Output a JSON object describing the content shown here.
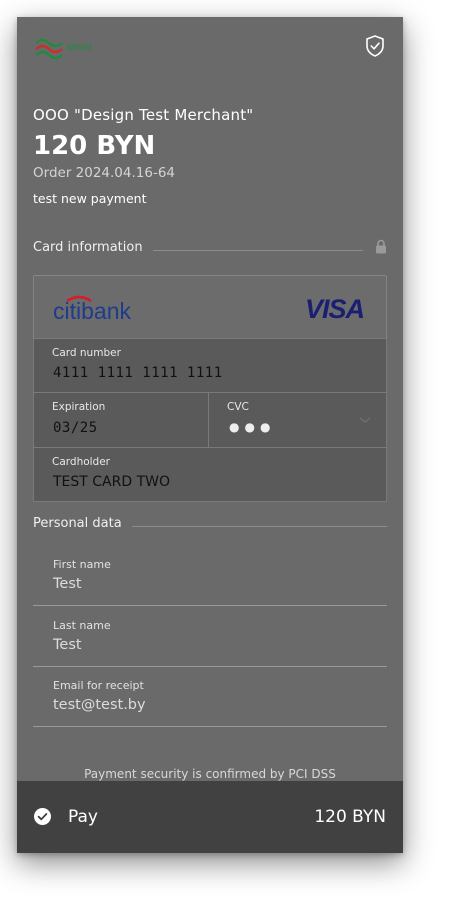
{
  "header": {
    "brand_text": "assist"
  },
  "merchant": {
    "name": "ООО \"Design Test Merchant\"",
    "amount": "120 BYN",
    "order": "Order 2024.04.16-64",
    "description": "test new payment"
  },
  "card_section": {
    "title": "Card information",
    "bank_logo": "citibank",
    "network": "VISA",
    "card_number_label": "Card number",
    "card_number": "4111  1111  1111  1111",
    "expiration_label": "Expiration",
    "expiration": "03/25",
    "cvc_label": "CVC",
    "cvc_masked": "●●●",
    "cardholder_label": "Cardholder",
    "cardholder": "TEST CARD TWO"
  },
  "personal_section": {
    "title": "Personal data",
    "first_name_label": "First name",
    "first_name": "Test",
    "last_name_label": "Last name",
    "last_name": "Test",
    "email_label": "Email for receipt",
    "email": "test@test.by"
  },
  "security_note": "Payment security is confirmed by PCI DSS",
  "pay": {
    "label": "Pay",
    "amount": "120 BYN"
  },
  "colors": {
    "panel_bg": "#6a6a6a",
    "paybar_bg": "#414141",
    "visa_blue": "#1a1f71",
    "citi_blue": "#1e3c8c",
    "citi_red": "#d0202a",
    "brand_green": "#1f8c3c"
  }
}
